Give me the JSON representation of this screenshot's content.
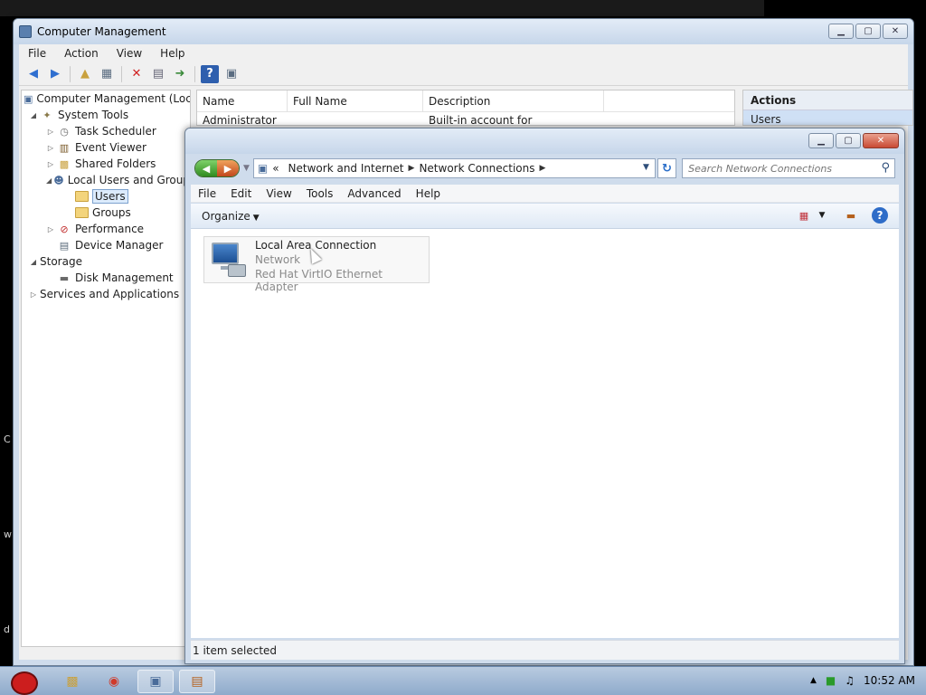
{
  "computer_management": {
    "title": "Computer Management",
    "menu": [
      "File",
      "Action",
      "View",
      "Help"
    ],
    "tree": [
      {
        "label": "Computer Management (Local",
        "level": 0,
        "expand": "",
        "icon": "computer-icon"
      },
      {
        "label": "System Tools",
        "level": 1,
        "expand": "open",
        "icon": "tools-icon"
      },
      {
        "label": "Task Scheduler",
        "level": 2,
        "expand": "closed",
        "icon": "clock-icon"
      },
      {
        "label": "Event Viewer",
        "level": 2,
        "expand": "closed",
        "icon": "event-viewer-icon"
      },
      {
        "label": "Shared Folders",
        "level": 2,
        "expand": "closed",
        "icon": "shared-folder-icon"
      },
      {
        "label": "Local Users and Group",
        "level": 2,
        "expand": "open",
        "icon": "users-icon"
      },
      {
        "label": "Users",
        "level": 3,
        "expand": "",
        "icon": "folder-icon",
        "selected": true
      },
      {
        "label": "Groups",
        "level": 3,
        "expand": "",
        "icon": "folder-icon"
      },
      {
        "label": "Performance",
        "level": 2,
        "expand": "closed",
        "icon": "performance-icon"
      },
      {
        "label": "Device Manager",
        "level": 2,
        "expand": "",
        "icon": "device-manager-icon"
      },
      {
        "label": "Storage",
        "level": 1,
        "expand": "open",
        "icon": ""
      },
      {
        "label": "Disk Management",
        "level": 2,
        "expand": "",
        "icon": "disk-icon"
      },
      {
        "label": "Services and Applications",
        "level": 1,
        "expand": "closed",
        "icon": ""
      }
    ],
    "list_columns": [
      "Name",
      "Full Name",
      "Description"
    ],
    "list_rows": [
      {
        "name": "Administrator",
        "full_name": "",
        "description": "Built-in account for administering..."
      }
    ],
    "actions_title": "Actions",
    "actions_item": "Users"
  },
  "network_connections": {
    "breadcrumb_prefix": "«",
    "breadcrumb": [
      "Network and Internet",
      "Network Connections"
    ],
    "search_placeholder": "Search Network Connections",
    "menu": [
      "File",
      "Edit",
      "View",
      "Tools",
      "Advanced",
      "Help"
    ],
    "organize_label": "Organize",
    "connection": {
      "name": "Local Area Connection",
      "status": "Network",
      "adapter": "Red Hat VirtIO Ethernet Adapter"
    },
    "status_text": "1 item selected"
  },
  "taskbar": {
    "clock": "10:52 AM"
  },
  "desktop_letters": [
    "C",
    "w",
    "d"
  ]
}
